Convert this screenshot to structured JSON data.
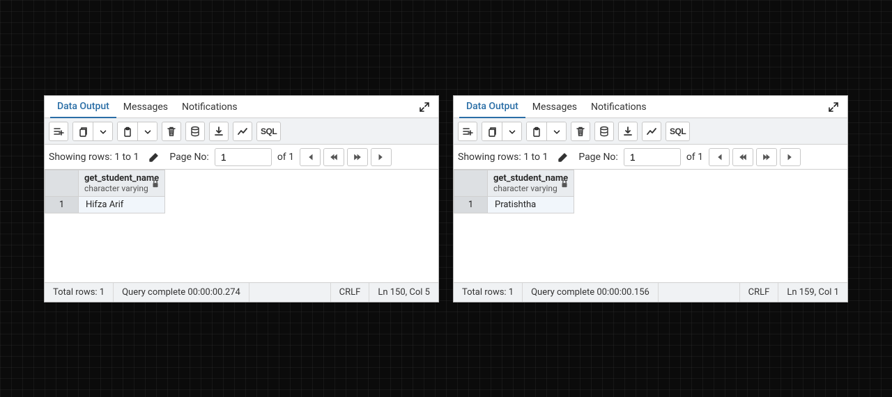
{
  "panels": [
    {
      "tabs": {
        "data_output": "Data Output",
        "messages": "Messages",
        "notifications": "Notifications"
      },
      "pager": {
        "showing": "Showing rows: 1 to 1",
        "page_label": "Page No:",
        "page_value": "1",
        "of": "of 1"
      },
      "column": {
        "name": "get_student_name",
        "type": "character varying"
      },
      "row": {
        "num": "1",
        "value": "Hifza Arif"
      },
      "status": {
        "total": "Total rows: 1",
        "query": "Query complete 00:00:00.274",
        "crlf": "CRLF",
        "pos": "Ln 150, Col 5"
      }
    },
    {
      "tabs": {
        "data_output": "Data Output",
        "messages": "Messages",
        "notifications": "Notifications"
      },
      "pager": {
        "showing": "Showing rows: 1 to 1",
        "page_label": "Page No:",
        "page_value": "1",
        "of": "of 1"
      },
      "column": {
        "name": "get_student_name",
        "type": "character varying"
      },
      "row": {
        "num": "1",
        "value": "Pratishtha"
      },
      "status": {
        "total": "Total rows: 1",
        "query": "Query complete 00:00:00.156",
        "crlf": "CRLF",
        "pos": "Ln 159, Col 1"
      }
    }
  ],
  "sql_label": "SQL"
}
